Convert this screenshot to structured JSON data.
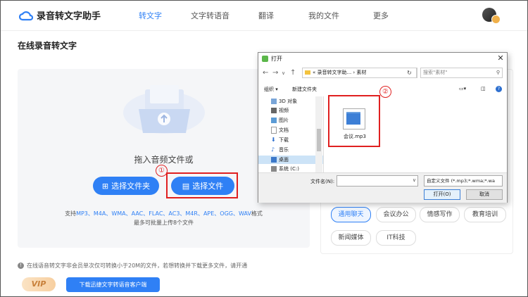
{
  "app": {
    "name": "录音转文字助手"
  },
  "nav": {
    "items": [
      "转文字",
      "文字转语音",
      "翻译",
      "我的文件",
      "更多"
    ],
    "active_index": 0
  },
  "page_title": "在线录音转文字",
  "upload": {
    "drop_text": "拖入音频文件或",
    "choose_folder": "选择文件夹",
    "choose_file": "选择文件",
    "formats_prefix": "支持",
    "formats": "MP3、M4A、WMA、AAC、FLAC、AC3、M4R、APE、OGG、WAV",
    "formats_suffix": "格式",
    "limit_text": "最多可批量上传8个文件"
  },
  "markers": {
    "one": "①",
    "two": "②"
  },
  "categories": [
    "通用聊天",
    "会议办公",
    "情感写作",
    "教育培训",
    "新闻媒体",
    "IT科技"
  ],
  "notice": "在线语音转文字非会员单次仅可转换小于20M的文件，若想转换并下载更多文件，请开通",
  "vip_label": "VIP",
  "download_client": "下载迅捷文字转语音客户端",
  "dialog": {
    "title": "打开",
    "path": "« 录音转文字助... › 素材",
    "search_placeholder": "搜索\"素材\"",
    "organize": "组织 ▾",
    "new_folder": "新建文件夹",
    "tree": [
      {
        "label": "3D 对象",
        "icon": "3d-objects-icon"
      },
      {
        "label": "视频",
        "icon": "video-icon"
      },
      {
        "label": "图片",
        "icon": "pictures-icon"
      },
      {
        "label": "文档",
        "icon": "documents-icon"
      },
      {
        "label": "下载",
        "icon": "download-icon"
      },
      {
        "label": "音乐",
        "icon": "music-icon"
      },
      {
        "label": "桌面",
        "icon": "desktop-icon"
      },
      {
        "label": "系统 (C:)",
        "icon": "drive-icon"
      }
    ],
    "selected_tree_index": 6,
    "file": {
      "name": "会议.mp3"
    },
    "filename_label": "文件名(N):",
    "filter": "自定义文件 (*.mp3;*.wma;*.wa",
    "open": "打开(O)",
    "cancel": "取消"
  },
  "colors": {
    "accent": "#2f80f5",
    "highlight": "#e02020"
  }
}
